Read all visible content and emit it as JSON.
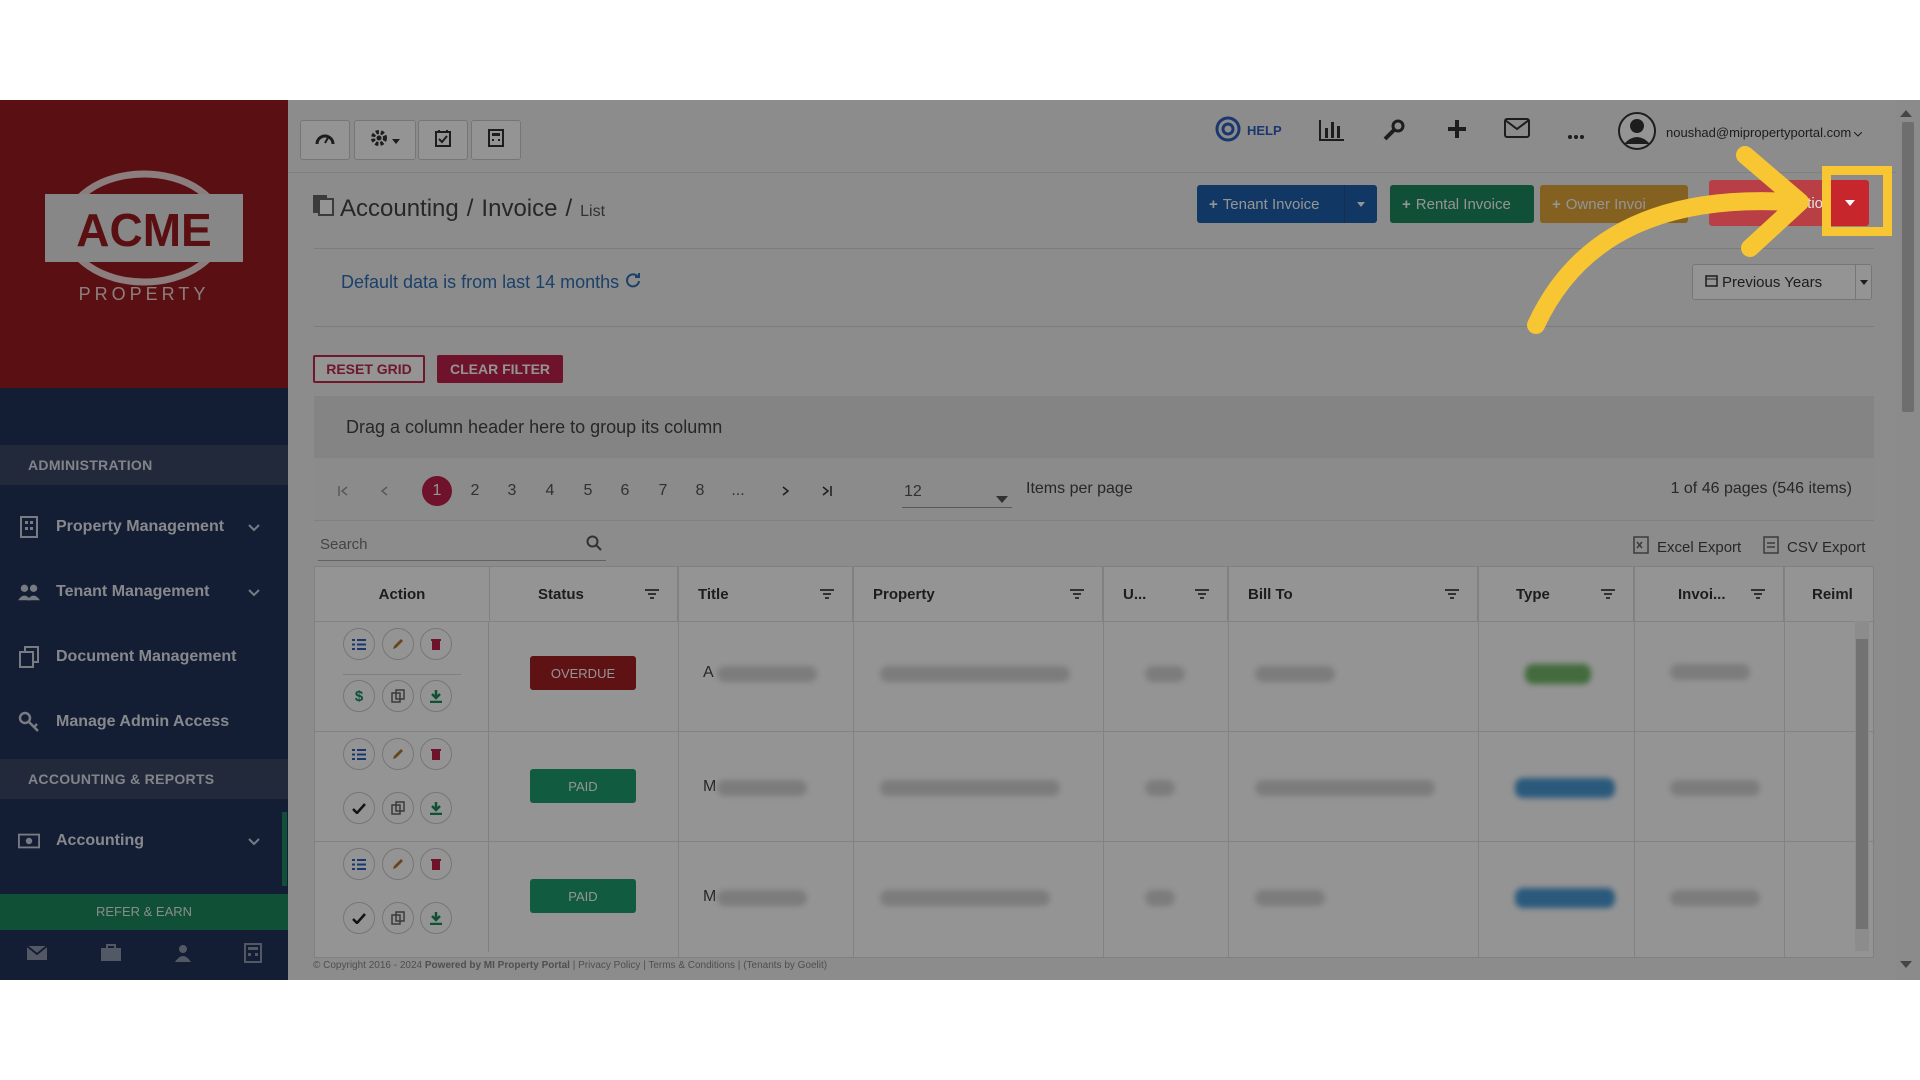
{
  "brand": {
    "name": "ACME",
    "sub": "PROPERTY"
  },
  "sidebar": {
    "section_admin": "ADMINISTRATION",
    "section_accounting": "ACCOUNTING & REPORTS",
    "items": [
      {
        "label": "Property Management",
        "icon": "building-icon"
      },
      {
        "label": "Tenant Management",
        "icon": "users-icon"
      },
      {
        "label": "Document Management",
        "icon": "documents-icon"
      },
      {
        "label": "Manage Admin Access",
        "icon": "key-icon"
      },
      {
        "label": "Accounting",
        "icon": "money-icon"
      }
    ],
    "refer": "REFER & EARN"
  },
  "topbar": {
    "help": "HELP",
    "user_email": "noushad@mipropertyportal.com"
  },
  "breadcrumb": {
    "part1": "Accounting",
    "part2": "Invoice",
    "part3": "List"
  },
  "actions": {
    "tenant_invoice": "Tenant Invoice",
    "rental_invoice": "Rental Invoice",
    "owner_invoice": "Owner Invoi",
    "other_action": "r Actio",
    "colors": {
      "tenant": "#1e5fae",
      "rental": "#1a8a5e",
      "owner": "#e3a83a",
      "other": "#c7262d"
    }
  },
  "notice": "Default data is from last 14 months",
  "period": "Previous Years",
  "buttons": {
    "reset_grid": "RESET GRID",
    "clear_filter": "CLEAR FILTER"
  },
  "group_hint": "Drag a column header here to group its column",
  "pager": {
    "pages": [
      "1",
      "2",
      "3",
      "4",
      "5",
      "6",
      "7",
      "8",
      "..."
    ],
    "page_size": "12",
    "items_per_page": "Items per page",
    "summary": "1 of 46 pages (546 items)"
  },
  "search": {
    "placeholder": "Search"
  },
  "exports": {
    "excel": "Excel Export",
    "csv": "CSV Export"
  },
  "columns": [
    "Action",
    "Status",
    "Title",
    "Property",
    "U...",
    "Bill To",
    "Type",
    "Invoi...",
    "Reiml"
  ],
  "rows": [
    {
      "status": "OVERDUE",
      "status_color": "#a31f24",
      "title_initial": "A"
    },
    {
      "status": "PAID",
      "status_color": "#1e9e6e",
      "title_initial": "M"
    },
    {
      "status": "PAID",
      "status_color": "#1e9e6e",
      "title_initial": "M"
    }
  ],
  "footer": {
    "copyright": "© Copyright 2016 - 2024",
    "powered": "Powered by MI Property Portal",
    "privacy": "Privacy Policy",
    "terms": "Terms & Conditions",
    "tenants": "(Tenants by Goelit)"
  }
}
